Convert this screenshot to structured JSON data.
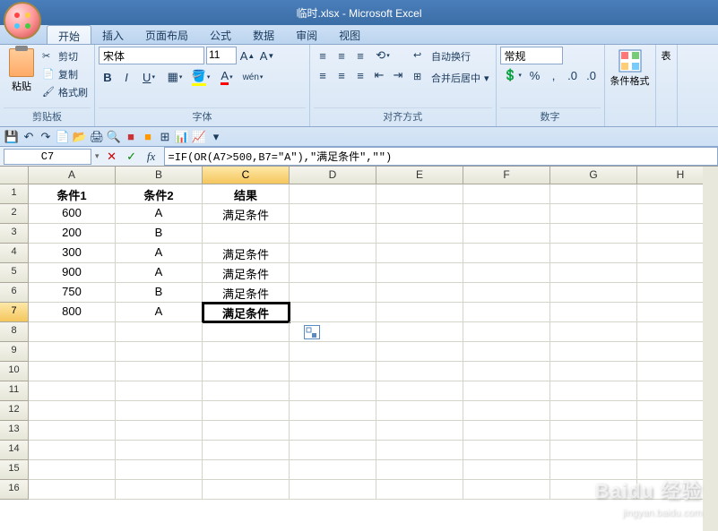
{
  "title": "临时.xlsx - Microsoft Excel",
  "tabs": [
    "开始",
    "插入",
    "页面布局",
    "公式",
    "数据",
    "审阅",
    "视图"
  ],
  "activeTab": 0,
  "ribbon": {
    "clipboard": {
      "label": "剪贴板",
      "paste": "粘贴",
      "cut": "剪切",
      "copy": "复制",
      "painter": "格式刷"
    },
    "font": {
      "label": "字体",
      "name": "宋体",
      "size": "11"
    },
    "align": {
      "label": "对齐方式",
      "wrap": "自动换行",
      "merge": "合并后居中"
    },
    "number": {
      "label": "数字",
      "format": "常规"
    },
    "cond": {
      "label": "条件格式"
    },
    "table": {
      "label": "表"
    }
  },
  "namebox": "C7",
  "formula": "=IF(OR(A7>500,B7=\"A\"),\"满足条件\",\"\")",
  "columns": [
    "A",
    "B",
    "C",
    "D",
    "E",
    "F",
    "G",
    "H"
  ],
  "selCol": 2,
  "selRow": 7,
  "rows": [
    {
      "n": 1,
      "A": "条件1",
      "B": "条件2",
      "C": "结果"
    },
    {
      "n": 2,
      "A": "600",
      "B": "A",
      "C": "满足条件"
    },
    {
      "n": 3,
      "A": "200",
      "B": "B",
      "C": ""
    },
    {
      "n": 4,
      "A": "300",
      "B": "A",
      "C": "满足条件"
    },
    {
      "n": 5,
      "A": "900",
      "B": "A",
      "C": "满足条件"
    },
    {
      "n": 6,
      "A": "750",
      "B": "B",
      "C": "满足条件"
    },
    {
      "n": 7,
      "A": "800",
      "B": "A",
      "C": "满足条件"
    },
    {
      "n": 8,
      "A": "",
      "B": "",
      "C": ""
    },
    {
      "n": 9,
      "A": "",
      "B": "",
      "C": ""
    },
    {
      "n": 10,
      "A": "",
      "B": "",
      "C": ""
    },
    {
      "n": 11,
      "A": "",
      "B": "",
      "C": ""
    },
    {
      "n": 12,
      "A": "",
      "B": "",
      "C": ""
    },
    {
      "n": 13,
      "A": "",
      "B": "",
      "C": ""
    },
    {
      "n": 14,
      "A": "",
      "B": "",
      "C": ""
    },
    {
      "n": 15,
      "A": "",
      "B": "",
      "C": ""
    },
    {
      "n": 16,
      "A": "",
      "B": "",
      "C": ""
    }
  ],
  "watermark": "Baidu 经验",
  "watermark_sub": "jingyan.baidu.com"
}
